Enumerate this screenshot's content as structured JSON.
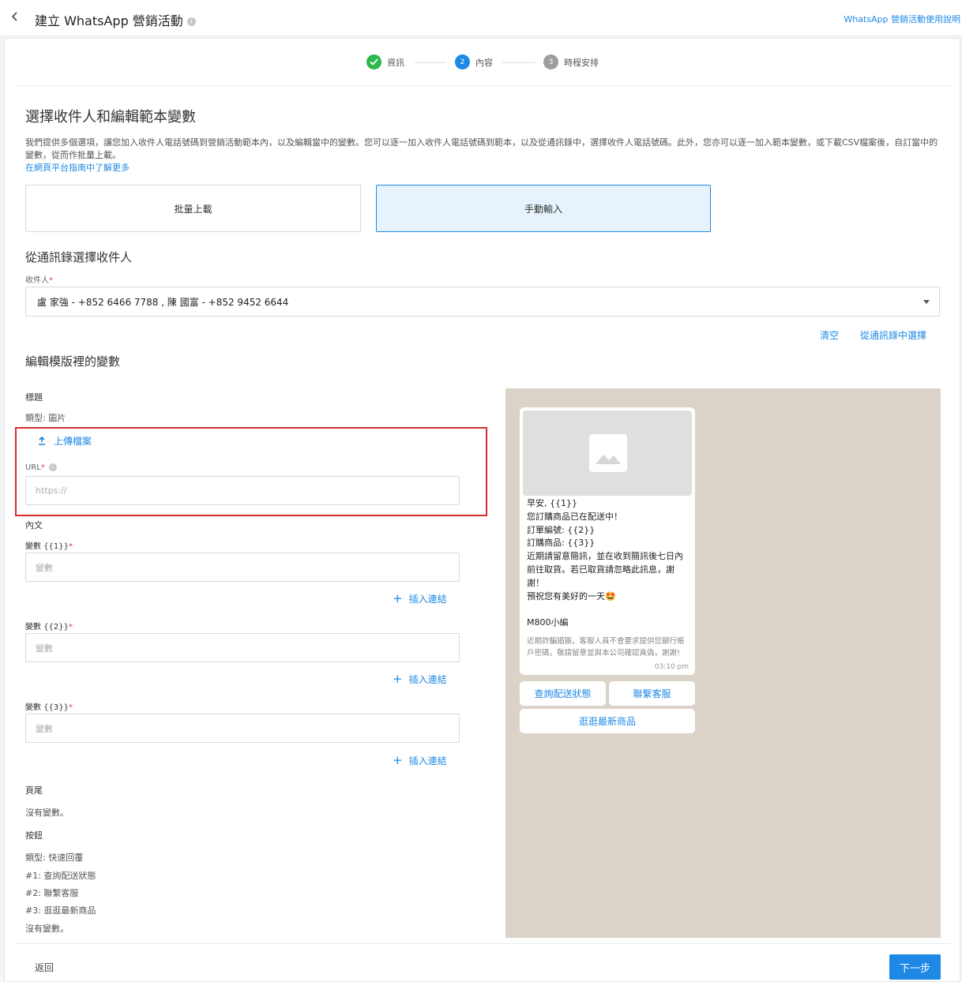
{
  "header": {
    "title": "建立 WhatsApp 營銷活動",
    "help_link": "WhatsApp 營銷活動使用說明"
  },
  "stepper": {
    "steps": [
      {
        "number": "✓",
        "label": "資訊",
        "state": "done",
        "color": "#2db84d"
      },
      {
        "number": "2",
        "label": "內容",
        "state": "active",
        "color": "#1e88e5"
      },
      {
        "number": "3",
        "label": "時程安排",
        "state": "pending",
        "color": "#9e9e9e"
      }
    ]
  },
  "section_recipients": {
    "title": "選擇收件人和編輯範本變數",
    "description": "我們提供多個選項，讓您加入收件人電話號碼到營銷活動範本內，以及編輯當中的變數。您可以逐一加入收件人電話號碼到範本，以及從通訊錄中，選擇收件人電話號碼。此外，您亦可以逐一加入範本變數，或下載CSV檔案後，自訂當中的變數，從而作批量上載。",
    "learn_more": "在網頁平台指南中了解更多",
    "options": [
      {
        "label": "批量上載",
        "active": false
      },
      {
        "label": "手動輸入",
        "active": true
      }
    ]
  },
  "contacts": {
    "title": "從通訊錄選擇收件人",
    "field_label": "收件人",
    "selected": "盧 家強 - +852 6466 7788 , 陳 國富 - +852 9452 6644",
    "clear_label": "清空",
    "choose_label": "從通訊錄中選擇"
  },
  "variables": {
    "title": "編輯模版裡的變數",
    "header_section": {
      "title": "標題",
      "type": "類型: 圖片",
      "upload_label": "上傳檔案",
      "url_label": "URL",
      "url_placeholder": "https://"
    },
    "body_section": {
      "title": "內文",
      "fields": [
        {
          "label": "變數 {{1}}",
          "placeholder": "變數",
          "insert_link": "插入連結"
        },
        {
          "label": "變數 {{2}}",
          "placeholder": "變數",
          "insert_link": "插入連結"
        },
        {
          "label": "變數 {{3}}",
          "placeholder": "變數",
          "insert_link": "插入連結"
        }
      ]
    },
    "footer_section": {
      "title": "頁尾",
      "note": "沒有變數。"
    },
    "buttons_section": {
      "title": "按鈕",
      "type": "類型: 快速回覆",
      "items": [
        "#1: 查詢配送狀態",
        "#2: 聯繫客服",
        "#3: 逛逛最新商品"
      ],
      "note": "沒有變數。"
    }
  },
  "preview": {
    "body": "早安, {{1}}\n您訂購商品已在配送中！\n訂單編號: {{2}}\n訂購商品: {{3}}\n近期請留意簡訊，並在收到簡訊後七日內前往取貨。若已取貨請忽略此訊息，謝謝！\n預祝您有美好的一天🤩\n\nM800小編",
    "footer": "近期詐騙猖獗，客服人員不會要求提供您銀行帳戶密碼，敬請留意並與本公司確認真偽，謝謝!",
    "time": "03:10 pm",
    "buttons": [
      "查詢配送狀態",
      "聯繫客服",
      "逛逛最新商品"
    ]
  },
  "footer_nav": {
    "back_label": "返回",
    "next_label": "下一步"
  }
}
